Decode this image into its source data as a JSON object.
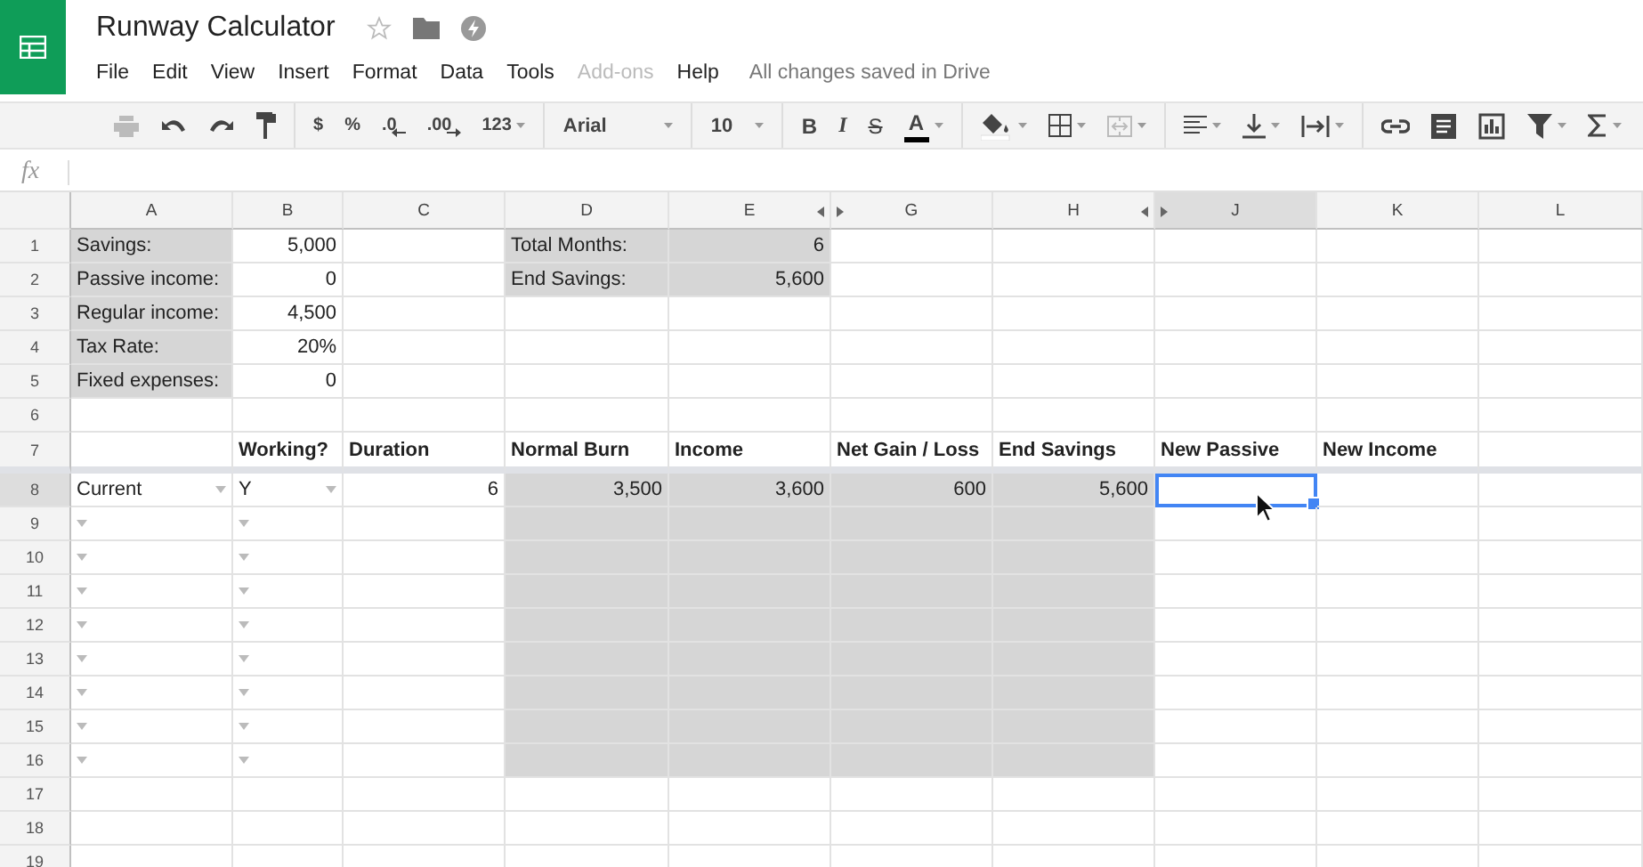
{
  "document": {
    "title": "Runway Calculator",
    "save_status": "All changes saved in Drive"
  },
  "menu": [
    {
      "label": "File",
      "disabled": false
    },
    {
      "label": "Edit",
      "disabled": false
    },
    {
      "label": "View",
      "disabled": false
    },
    {
      "label": "Insert",
      "disabled": false
    },
    {
      "label": "Format",
      "disabled": false
    },
    {
      "label": "Data",
      "disabled": false
    },
    {
      "label": "Tools",
      "disabled": false
    },
    {
      "label": "Add-ons",
      "disabled": true
    },
    {
      "label": "Help",
      "disabled": false
    }
  ],
  "toolbar": [
    [
      {
        "kind": "print",
        "disabled": true
      },
      {
        "kind": "undo",
        "disabled": false
      },
      {
        "kind": "redo",
        "disabled": false
      },
      {
        "kind": "paint",
        "disabled": false
      }
    ],
    [
      {
        "kind": "text",
        "label": "$",
        "disabled": false
      },
      {
        "kind": "text",
        "label": "%",
        "disabled": false
      },
      {
        "kind": "decrease",
        "label": ".0",
        "disabled": false
      },
      {
        "kind": "increase",
        "label": ".00",
        "disabled": false
      },
      {
        "kind": "menu",
        "label": "123",
        "disabled": false
      }
    ],
    [
      {
        "kind": "select",
        "label": "Arial",
        "disabled": false
      }
    ],
    [
      {
        "kind": "select",
        "label": "10",
        "disabled": false
      }
    ],
    [
      {
        "kind": "bold",
        "label": "B",
        "disabled": false
      },
      {
        "kind": "italic",
        "label": "I",
        "disabled": false
      },
      {
        "kind": "strike",
        "label": "S",
        "disabled": false
      },
      {
        "kind": "color",
        "label": "A",
        "disabled": false
      }
    ],
    [
      {
        "kind": "fill",
        "disabled": false
      },
      {
        "kind": "borders",
        "disabled": false
      },
      {
        "kind": "merge",
        "disabled": true
      }
    ],
    [
      {
        "kind": "align",
        "disabled": false
      },
      {
        "kind": "valign",
        "disabled": false
      },
      {
        "kind": "wrap",
        "disabled": false
      }
    ],
    [
      {
        "kind": "link",
        "disabled": false
      },
      {
        "kind": "comment",
        "disabled": false
      },
      {
        "kind": "chart",
        "disabled": false
      },
      {
        "kind": "filter",
        "disabled": false
      },
      {
        "kind": "sum",
        "disabled": false
      }
    ]
  ],
  "formula_bar": {
    "label": "fx"
  },
  "sheet": {
    "columns": [
      {
        "label": "A",
        "selected": false,
        "hidden_column_after": false
      },
      {
        "label": "B",
        "selected": false,
        "hidden_column_after": false
      },
      {
        "label": "C",
        "selected": false,
        "hidden_column_after": false
      },
      {
        "label": "D",
        "selected": false,
        "hidden_column_after": false
      },
      {
        "label": "E",
        "selected": false,
        "hidden_column_after": true
      },
      {
        "label": "G",
        "selected": false,
        "hidden_column_after": false
      },
      {
        "label": "H",
        "selected": false,
        "hidden_column_after": true
      },
      {
        "label": "J",
        "selected": true,
        "hidden_column_after": false
      },
      {
        "label": "K",
        "selected": false,
        "hidden_column_after": false
      },
      {
        "label": "L",
        "selected": false,
        "hidden_column_after": false
      }
    ],
    "rows": [
      {
        "number": "1",
        "selected": false,
        "freeze_below": false,
        "cells": [
          {
            "text": "Savings:",
            "kind": "text",
            "shaded": true,
            "dropdown": false,
            "selected": false
          },
          {
            "text": "5,000",
            "kind": "number",
            "shaded": false,
            "dropdown": false,
            "selected": false
          },
          {
            "shaded": false,
            "dropdown": false,
            "selected": false
          },
          {
            "text": "Total Months:",
            "kind": "text",
            "shaded": true,
            "dropdown": false,
            "selected": false
          },
          {
            "text": "6",
            "kind": "number",
            "shaded": true,
            "dropdown": false,
            "selected": false
          },
          {
            "shaded": false,
            "dropdown": false,
            "selected": false
          },
          {
            "shaded": false,
            "dropdown": false,
            "selected": false
          },
          {
            "shaded": false,
            "dropdown": false,
            "selected": false
          },
          {
            "shaded": false,
            "dropdown": false,
            "selected": false
          },
          {
            "shaded": false,
            "dropdown": false,
            "selected": false
          }
        ]
      },
      {
        "number": "2",
        "selected": false,
        "freeze_below": false,
        "cells": [
          {
            "text": "Passive income:",
            "kind": "text",
            "shaded": true,
            "dropdown": false,
            "selected": false
          },
          {
            "text": "0",
            "kind": "number",
            "shaded": false,
            "dropdown": false,
            "selected": false
          },
          {
            "shaded": false,
            "dropdown": false,
            "selected": false
          },
          {
            "text": "End Savings:",
            "kind": "text",
            "shaded": true,
            "dropdown": false,
            "selected": false
          },
          {
            "text": "5,600",
            "kind": "number",
            "shaded": true,
            "dropdown": false,
            "selected": false
          },
          {
            "shaded": false,
            "dropdown": false,
            "selected": false
          },
          {
            "shaded": false,
            "dropdown": false,
            "selected": false
          },
          {
            "shaded": false,
            "dropdown": false,
            "selected": false
          },
          {
            "shaded": false,
            "dropdown": false,
            "selected": false
          },
          {
            "shaded": false,
            "dropdown": false,
            "selected": false
          }
        ]
      },
      {
        "number": "3",
        "selected": false,
        "freeze_below": false,
        "cells": [
          {
            "text": "Regular income:",
            "kind": "text",
            "shaded": true,
            "dropdown": false,
            "selected": false
          },
          {
            "text": "4,500",
            "kind": "number",
            "shaded": false,
            "dropdown": false,
            "selected": false
          },
          {
            "shaded": false,
            "dropdown": false,
            "selected": false
          },
          {
            "shaded": false,
            "dropdown": false,
            "selected": false
          },
          {
            "shaded": false,
            "dropdown": false,
            "selected": false
          },
          {
            "shaded": false,
            "dropdown": false,
            "selected": false
          },
          {
            "shaded": false,
            "dropdown": false,
            "selected": false
          },
          {
            "shaded": false,
            "dropdown": false,
            "selected": false
          },
          {
            "shaded": false,
            "dropdown": false,
            "selected": false
          },
          {
            "shaded": false,
            "dropdown": false,
            "selected": false
          }
        ]
      },
      {
        "number": "4",
        "selected": false,
        "freeze_below": false,
        "cells": [
          {
            "text": "Tax Rate:",
            "kind": "text",
            "shaded": true,
            "dropdown": false,
            "selected": false
          },
          {
            "text": "20%",
            "kind": "number",
            "shaded": false,
            "dropdown": false,
            "selected": false
          },
          {
            "shaded": false,
            "dropdown": false,
            "selected": false
          },
          {
            "shaded": false,
            "dropdown": false,
            "selected": false
          },
          {
            "shaded": false,
            "dropdown": false,
            "selected": false
          },
          {
            "shaded": false,
            "dropdown": false,
            "selected": false
          },
          {
            "shaded": false,
            "dropdown": false,
            "selected": false
          },
          {
            "shaded": false,
            "dropdown": false,
            "selected": false
          },
          {
            "shaded": false,
            "dropdown": false,
            "selected": false
          },
          {
            "shaded": false,
            "dropdown": false,
            "selected": false
          }
        ]
      },
      {
        "number": "5",
        "selected": false,
        "freeze_below": false,
        "cells": [
          {
            "text": "Fixed expenses:",
            "kind": "text",
            "shaded": true,
            "dropdown": false,
            "selected": false
          },
          {
            "text": "0",
            "kind": "number",
            "shaded": false,
            "dropdown": false,
            "selected": false
          },
          {
            "shaded": false,
            "dropdown": false,
            "selected": false
          },
          {
            "shaded": false,
            "dropdown": false,
            "selected": false
          },
          {
            "shaded": false,
            "dropdown": false,
            "selected": false
          },
          {
            "shaded": false,
            "dropdown": false,
            "selected": false
          },
          {
            "shaded": false,
            "dropdown": false,
            "selected": false
          },
          {
            "shaded": false,
            "dropdown": false,
            "selected": false
          },
          {
            "shaded": false,
            "dropdown": false,
            "selected": false
          },
          {
            "shaded": false,
            "dropdown": false,
            "selected": false
          }
        ]
      },
      {
        "number": "6",
        "selected": false,
        "freeze_below": false,
        "cells": [
          {
            "shaded": false,
            "dropdown": false,
            "selected": false
          },
          {
            "shaded": false,
            "dropdown": false,
            "selected": false
          },
          {
            "shaded": false,
            "dropdown": false,
            "selected": false
          },
          {
            "shaded": false,
            "dropdown": false,
            "selected": false
          },
          {
            "shaded": false,
            "dropdown": false,
            "selected": false
          },
          {
            "shaded": false,
            "dropdown": false,
            "selected": false
          },
          {
            "shaded": false,
            "dropdown": false,
            "selected": false
          },
          {
            "shaded": false,
            "dropdown": false,
            "selected": false
          },
          {
            "shaded": false,
            "dropdown": false,
            "selected": false
          },
          {
            "shaded": false,
            "dropdown": false,
            "selected": false
          }
        ]
      },
      {
        "number": "7",
        "selected": false,
        "freeze_below": true,
        "cells": [
          {
            "shaded": false,
            "dropdown": false,
            "selected": false
          },
          {
            "text": "Working?",
            "kind": "heading",
            "shaded": false,
            "dropdown": false,
            "selected": false
          },
          {
            "text": "Duration",
            "kind": "heading",
            "shaded": false,
            "dropdown": false,
            "selected": false
          },
          {
            "text": "Normal Burn",
            "kind": "heading",
            "shaded": false,
            "dropdown": false,
            "selected": false
          },
          {
            "text": "Income",
            "kind": "heading",
            "shaded": false,
            "dropdown": false,
            "selected": false
          },
          {
            "text": "Net Gain / Loss",
            "kind": "heading",
            "shaded": false,
            "dropdown": false,
            "selected": false
          },
          {
            "text": "End Savings",
            "kind": "heading",
            "shaded": false,
            "dropdown": false,
            "selected": false
          },
          {
            "text": "New Passive",
            "kind": "heading",
            "shaded": false,
            "dropdown": false,
            "selected": false
          },
          {
            "text": "New Income",
            "kind": "heading",
            "shaded": false,
            "dropdown": false,
            "selected": false
          },
          {
            "shaded": false,
            "dropdown": false,
            "selected": false
          }
        ]
      },
      {
        "number": "8",
        "selected": true,
        "freeze_below": false,
        "cells": [
          {
            "text": "Current",
            "kind": "text",
            "shaded": false,
            "dropdown": true,
            "selected": false
          },
          {
            "text": "Y",
            "kind": "text",
            "shaded": false,
            "dropdown": true,
            "selected": false
          },
          {
            "text": "6",
            "kind": "number",
            "shaded": false,
            "dropdown": false,
            "selected": false
          },
          {
            "text": "3,500",
            "kind": "number",
            "shaded": true,
            "dropdown": false,
            "selected": false
          },
          {
            "text": "3,600",
            "kind": "number",
            "shaded": true,
            "dropdown": false,
            "selected": false
          },
          {
            "text": "600",
            "kind": "number",
            "shaded": true,
            "dropdown": false,
            "selected": false
          },
          {
            "text": "5,600",
            "kind": "number",
            "shaded": true,
            "dropdown": false,
            "selected": false
          },
          {
            "shaded": false,
            "dropdown": false,
            "selected": true
          },
          {
            "shaded": false,
            "dropdown": false,
            "selected": false
          },
          {
            "shaded": false,
            "dropdown": false,
            "selected": false
          }
        ]
      },
      {
        "number": "9",
        "selected": false,
        "freeze_below": false,
        "cells": [
          {
            "shaded": false,
            "dropdown": true,
            "selected": false
          },
          {
            "shaded": false,
            "dropdown": true,
            "selected": false
          },
          {
            "shaded": false,
            "dropdown": false,
            "selected": false
          },
          {
            "shaded": true,
            "dropdown": false,
            "selected": false
          },
          {
            "shaded": true,
            "dropdown": false,
            "selected": false
          },
          {
            "shaded": true,
            "dropdown": false,
            "selected": false
          },
          {
            "shaded": true,
            "dropdown": false,
            "selected": false
          },
          {
            "shaded": false,
            "dropdown": false,
            "selected": false
          },
          {
            "shaded": false,
            "dropdown": false,
            "selected": false
          },
          {
            "shaded": false,
            "dropdown": false,
            "selected": false
          }
        ]
      },
      {
        "number": "10",
        "selected": false,
        "freeze_below": false,
        "cells": [
          {
            "shaded": false,
            "dropdown": true,
            "selected": false
          },
          {
            "shaded": false,
            "dropdown": true,
            "selected": false
          },
          {
            "shaded": false,
            "dropdown": false,
            "selected": false
          },
          {
            "shaded": true,
            "dropdown": false,
            "selected": false
          },
          {
            "shaded": true,
            "dropdown": false,
            "selected": false
          },
          {
            "shaded": true,
            "dropdown": false,
            "selected": false
          },
          {
            "shaded": true,
            "dropdown": false,
            "selected": false
          },
          {
            "shaded": false,
            "dropdown": false,
            "selected": false
          },
          {
            "shaded": false,
            "dropdown": false,
            "selected": false
          },
          {
            "shaded": false,
            "dropdown": false,
            "selected": false
          }
        ]
      },
      {
        "number": "11",
        "selected": false,
        "freeze_below": false,
        "cells": [
          {
            "shaded": false,
            "dropdown": true,
            "selected": false
          },
          {
            "shaded": false,
            "dropdown": true,
            "selected": false
          },
          {
            "shaded": false,
            "dropdown": false,
            "selected": false
          },
          {
            "shaded": true,
            "dropdown": false,
            "selected": false
          },
          {
            "shaded": true,
            "dropdown": false,
            "selected": false
          },
          {
            "shaded": true,
            "dropdown": false,
            "selected": false
          },
          {
            "shaded": true,
            "dropdown": false,
            "selected": false
          },
          {
            "shaded": false,
            "dropdown": false,
            "selected": false
          },
          {
            "shaded": false,
            "dropdown": false,
            "selected": false
          },
          {
            "shaded": false,
            "dropdown": false,
            "selected": false
          }
        ]
      },
      {
        "number": "12",
        "selected": false,
        "freeze_below": false,
        "cells": [
          {
            "shaded": false,
            "dropdown": true,
            "selected": false
          },
          {
            "shaded": false,
            "dropdown": true,
            "selected": false
          },
          {
            "shaded": false,
            "dropdown": false,
            "selected": false
          },
          {
            "shaded": true,
            "dropdown": false,
            "selected": false
          },
          {
            "shaded": true,
            "dropdown": false,
            "selected": false
          },
          {
            "shaded": true,
            "dropdown": false,
            "selected": false
          },
          {
            "shaded": true,
            "dropdown": false,
            "selected": false
          },
          {
            "shaded": false,
            "dropdown": false,
            "selected": false
          },
          {
            "shaded": false,
            "dropdown": false,
            "selected": false
          },
          {
            "shaded": false,
            "dropdown": false,
            "selected": false
          }
        ]
      },
      {
        "number": "13",
        "selected": false,
        "freeze_below": false,
        "cells": [
          {
            "shaded": false,
            "dropdown": true,
            "selected": false
          },
          {
            "shaded": false,
            "dropdown": true,
            "selected": false
          },
          {
            "shaded": false,
            "dropdown": false,
            "selected": false
          },
          {
            "shaded": true,
            "dropdown": false,
            "selected": false
          },
          {
            "shaded": true,
            "dropdown": false,
            "selected": false
          },
          {
            "shaded": true,
            "dropdown": false,
            "selected": false
          },
          {
            "shaded": true,
            "dropdown": false,
            "selected": false
          },
          {
            "shaded": false,
            "dropdown": false,
            "selected": false
          },
          {
            "shaded": false,
            "dropdown": false,
            "selected": false
          },
          {
            "shaded": false,
            "dropdown": false,
            "selected": false
          }
        ]
      },
      {
        "number": "14",
        "selected": false,
        "freeze_below": false,
        "cells": [
          {
            "shaded": false,
            "dropdown": true,
            "selected": false
          },
          {
            "shaded": false,
            "dropdown": true,
            "selected": false
          },
          {
            "shaded": false,
            "dropdown": false,
            "selected": false
          },
          {
            "shaded": true,
            "dropdown": false,
            "selected": false
          },
          {
            "shaded": true,
            "dropdown": false,
            "selected": false
          },
          {
            "shaded": true,
            "dropdown": false,
            "selected": false
          },
          {
            "shaded": true,
            "dropdown": false,
            "selected": false
          },
          {
            "shaded": false,
            "dropdown": false,
            "selected": false
          },
          {
            "shaded": false,
            "dropdown": false,
            "selected": false
          },
          {
            "shaded": false,
            "dropdown": false,
            "selected": false
          }
        ]
      },
      {
        "number": "15",
        "selected": false,
        "freeze_below": false,
        "cells": [
          {
            "shaded": false,
            "dropdown": true,
            "selected": false
          },
          {
            "shaded": false,
            "dropdown": true,
            "selected": false
          },
          {
            "shaded": false,
            "dropdown": false,
            "selected": false
          },
          {
            "shaded": true,
            "dropdown": false,
            "selected": false
          },
          {
            "shaded": true,
            "dropdown": false,
            "selected": false
          },
          {
            "shaded": true,
            "dropdown": false,
            "selected": false
          },
          {
            "shaded": true,
            "dropdown": false,
            "selected": false
          },
          {
            "shaded": false,
            "dropdown": false,
            "selected": false
          },
          {
            "shaded": false,
            "dropdown": false,
            "selected": false
          },
          {
            "shaded": false,
            "dropdown": false,
            "selected": false
          }
        ]
      },
      {
        "number": "16",
        "selected": false,
        "freeze_below": false,
        "cells": [
          {
            "shaded": false,
            "dropdown": true,
            "selected": false
          },
          {
            "shaded": false,
            "dropdown": true,
            "selected": false
          },
          {
            "shaded": false,
            "dropdown": false,
            "selected": false
          },
          {
            "shaded": true,
            "dropdown": false,
            "selected": false
          },
          {
            "shaded": true,
            "dropdown": false,
            "selected": false
          },
          {
            "shaded": true,
            "dropdown": false,
            "selected": false
          },
          {
            "shaded": true,
            "dropdown": false,
            "selected": false
          },
          {
            "shaded": false,
            "dropdown": false,
            "selected": false
          },
          {
            "shaded": false,
            "dropdown": false,
            "selected": false
          },
          {
            "shaded": false,
            "dropdown": false,
            "selected": false
          }
        ]
      },
      {
        "number": "17",
        "selected": false,
        "freeze_below": false,
        "cells": [
          {
            "shaded": false,
            "dropdown": false,
            "selected": false
          },
          {
            "shaded": false,
            "dropdown": false,
            "selected": false
          },
          {
            "shaded": false,
            "dropdown": false,
            "selected": false
          },
          {
            "shaded": false,
            "dropdown": false,
            "selected": false
          },
          {
            "shaded": false,
            "dropdown": false,
            "selected": false
          },
          {
            "shaded": false,
            "dropdown": false,
            "selected": false
          },
          {
            "shaded": false,
            "dropdown": false,
            "selected": false
          },
          {
            "shaded": false,
            "dropdown": false,
            "selected": false
          },
          {
            "shaded": false,
            "dropdown": false,
            "selected": false
          },
          {
            "shaded": false,
            "dropdown": false,
            "selected": false
          }
        ]
      },
      {
        "number": "18",
        "selected": false,
        "freeze_below": false,
        "cells": [
          {
            "shaded": false,
            "dropdown": false,
            "selected": false
          },
          {
            "shaded": false,
            "dropdown": false,
            "selected": false
          },
          {
            "shaded": false,
            "dropdown": false,
            "selected": false
          },
          {
            "shaded": false,
            "dropdown": false,
            "selected": false
          },
          {
            "shaded": false,
            "dropdown": false,
            "selected": false
          },
          {
            "shaded": false,
            "dropdown": false,
            "selected": false
          },
          {
            "shaded": false,
            "dropdown": false,
            "selected": false
          },
          {
            "shaded": false,
            "dropdown": false,
            "selected": false
          },
          {
            "shaded": false,
            "dropdown": false,
            "selected": false
          },
          {
            "shaded": false,
            "dropdown": false,
            "selected": false
          }
        ]
      },
      {
        "number": "19",
        "selected": false,
        "freeze_below": false,
        "cells": [
          {
            "shaded": false,
            "dropdown": false,
            "selected": false
          },
          {
            "shaded": false,
            "dropdown": false,
            "selected": false
          },
          {
            "shaded": false,
            "dropdown": false,
            "selected": false
          },
          {
            "shaded": false,
            "dropdown": false,
            "selected": false
          },
          {
            "shaded": false,
            "dropdown": false,
            "selected": false
          },
          {
            "shaded": false,
            "dropdown": false,
            "selected": false
          },
          {
            "shaded": false,
            "dropdown": false,
            "selected": false
          },
          {
            "shaded": false,
            "dropdown": false,
            "selected": false
          },
          {
            "shaded": false,
            "dropdown": false,
            "selected": false
          },
          {
            "shaded": false,
            "dropdown": false,
            "selected": false
          }
        ]
      }
    ]
  }
}
